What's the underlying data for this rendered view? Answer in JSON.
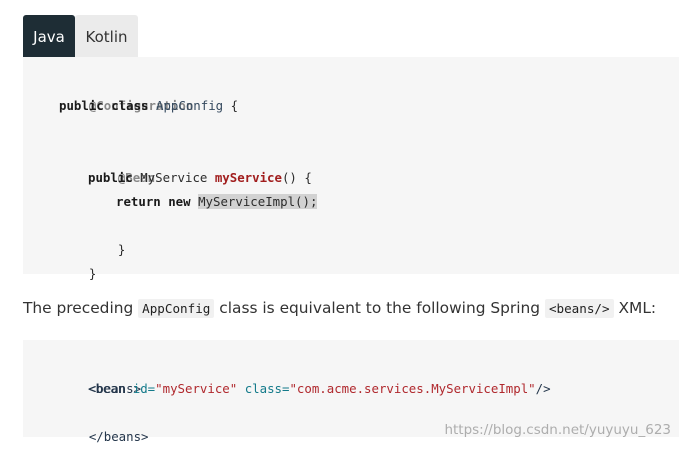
{
  "tabs": [
    {
      "label": "Java",
      "active": true
    },
    {
      "label": "Kotlin",
      "active": false
    }
  ],
  "java_code": {
    "annotation_configuration": "@Configuration",
    "class_kw": "public class",
    "class_name": "AppConfig",
    "open_brace": " {",
    "annotation_bean": "@Bean",
    "method_kw": "public",
    "return_type": " MyService ",
    "method_name": "myService",
    "method_sig_rest": "() {",
    "return_kw": "return new",
    "new_expr": "MyServiceImpl();",
    "close_inner": "}",
    "close_outer": "}"
  },
  "paragraph": {
    "before": "The preceding ",
    "code1": "AppConfig",
    "middle": " class is equivalent to the following Spring ",
    "code2": "<beans/>",
    "after": " XML:"
  },
  "xml_code": {
    "beans_open": "<beans>",
    "bean_tag_open": "<bean ",
    "id_attr": "id=",
    "id_value": "\"myService\"",
    "class_attr": "class=",
    "class_value": "\"com.acme.services.MyServiceImpl\"",
    "bean_tag_close": "/>",
    "beans_close": "</beans>"
  },
  "watermark": "https://blog.csdn.net/yuyuyu_623",
  "colors": {
    "tab_active_bg": "#1e2d35",
    "tab_inactive_bg": "#ebebeb",
    "code_bg": "#f6f6f6",
    "method_name": "#a11d1d",
    "xml_attr": "#137a8a",
    "xml_string": "#b0282d"
  }
}
